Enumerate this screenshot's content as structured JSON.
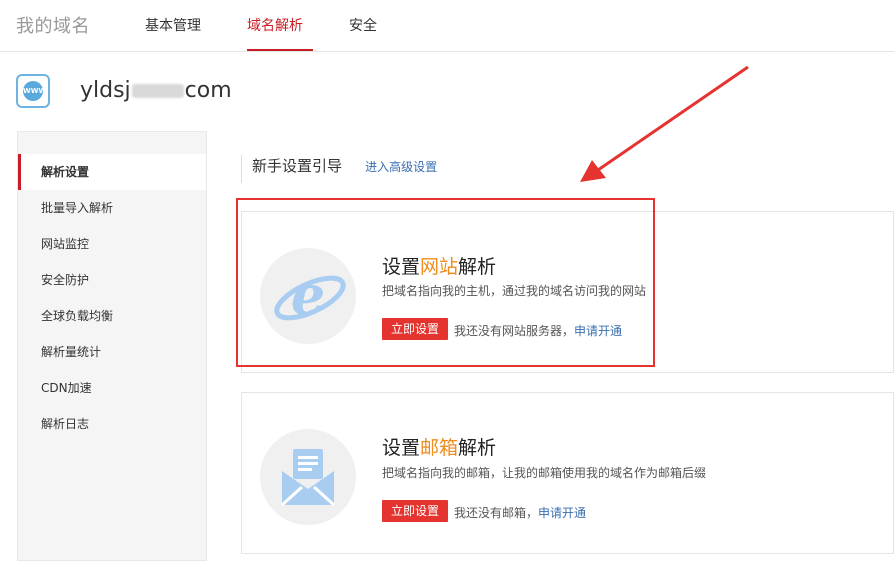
{
  "header": {
    "brand": "我的域名",
    "tabs": [
      {
        "label": "基本管理"
      },
      {
        "label": "域名解析"
      },
      {
        "label": "安全"
      }
    ]
  },
  "domain": {
    "prefix": "yldsj",
    "suffix": "com",
    "icon": "www-globe-icon"
  },
  "sidebar": {
    "items": [
      {
        "label": "解析设置"
      },
      {
        "label": "批量导入解析"
      },
      {
        "label": "网站监控"
      },
      {
        "label": "安全防护"
      },
      {
        "label": "全球负载均衡"
      },
      {
        "label": "解析量统计"
      },
      {
        "label": "CDN加速"
      },
      {
        "label": "解析日志"
      }
    ]
  },
  "guide": {
    "title": "新手设置引导",
    "advanced_link": "进入高级设置"
  },
  "cards": [
    {
      "title_pre": "设置",
      "title_hl": "网站",
      "title_post": "解析",
      "desc": "把域名指向我的主机，通过我的域名访问我的网站",
      "button": "立即设置",
      "note": "我还没有网站服务器，",
      "note_link": "申请开通",
      "icon": "ie-browser-icon"
    },
    {
      "title_pre": "设置",
      "title_hl": "邮箱",
      "title_post": "解析",
      "desc": "把域名指向我的邮箱，让我的邮箱使用我的域名作为邮箱后缀",
      "button": "立即设置",
      "note": "我还没有邮箱，",
      "note_link": "申请开通",
      "icon": "mail-envelope-icon"
    }
  ],
  "colors": {
    "accent_red": "#c81d25",
    "button_red": "#e5342f",
    "highlight_orange": "#f08b1d",
    "link_blue": "#3a6fb0"
  }
}
